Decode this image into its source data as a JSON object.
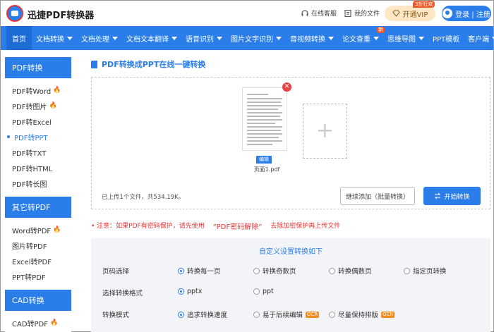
{
  "header": {
    "brand": "迅捷PDF转换器",
    "online_service": "在线客服",
    "my_files": "我的文件",
    "vip_badge": "3折狂欢",
    "vip_label": "开通VIP",
    "login_label": "登录 | 注册"
  },
  "nav": {
    "items": [
      {
        "label": "首页",
        "caret": false
      },
      {
        "label": "文档转换",
        "caret": true
      },
      {
        "label": "文档处理",
        "caret": true
      },
      {
        "label": "文档文本翻译",
        "caret": true
      },
      {
        "label": "语音识别",
        "caret": true
      },
      {
        "label": "图片文字识别",
        "caret": true
      },
      {
        "label": "音视频转换",
        "caret": true
      },
      {
        "label": "论文查重",
        "caret": true,
        "badge": "新"
      },
      {
        "label": "思维导图",
        "caret": true
      },
      {
        "label": "PPT模板",
        "caret": false
      },
      {
        "label": "客户端",
        "caret": true
      }
    ]
  },
  "sidebar": {
    "sections": [
      {
        "title": "PDF转换",
        "items": [
          {
            "label": "PDF转Word",
            "hot": true
          },
          {
            "label": "PDF转图片",
            "hot": true
          },
          {
            "label": "PDF转Excel",
            "hot": false
          },
          {
            "label": "PDF转PPT",
            "hot": false,
            "active": true
          },
          {
            "label": "PDF转TXT",
            "hot": false
          },
          {
            "label": "PDF转HTML",
            "hot": false
          },
          {
            "label": "PDF转长图",
            "hot": false
          }
        ]
      },
      {
        "title": "其它转PDF",
        "items": [
          {
            "label": "Word转PDF",
            "hot": true
          },
          {
            "label": "图片转PDF",
            "hot": false
          },
          {
            "label": "Excel转PDF",
            "hot": false
          },
          {
            "label": "PPT转PDF",
            "hot": false
          }
        ]
      },
      {
        "title": "CAD转换",
        "items": [
          {
            "label": "CAD转PDF",
            "hot": true
          }
        ]
      }
    ]
  },
  "main": {
    "title": "PDF转换成PPT在线一键转换",
    "upload": {
      "edit_label": "编辑",
      "file_name": "页面1.pdf",
      "status": "已上传1个文件，共534.19K。",
      "batch_add_label": "继续添加（批量转换）",
      "start_label": "开始转换"
    },
    "notice": {
      "prefix": "• 注意：如果PDF有密码保护，请先使用",
      "link": "“PDF密码解除”",
      "suffix": "去除加密保护再上传文件"
    },
    "settings": {
      "title": "自定义设置转换如下",
      "rows": [
        {
          "label": "页码选择",
          "options": [
            {
              "label": "转换每一页",
              "selected": true,
              "ocr": false
            },
            {
              "label": "转换奇数页",
              "selected": false,
              "ocr": false
            },
            {
              "label": "转换偶数页",
              "selected": false,
              "ocr": false
            },
            {
              "label": "指定页转换",
              "selected": false,
              "ocr": false
            }
          ]
        },
        {
          "label": "选择转换格式",
          "options": [
            {
              "label": "pptx",
              "selected": true,
              "ocr": false
            },
            {
              "label": "ppt",
              "selected": false,
              "ocr": false
            }
          ]
        },
        {
          "label": "转换模式",
          "options": [
            {
              "label": "追求转换速度",
              "selected": true,
              "ocr": false
            },
            {
              "label": "易于后续编辑",
              "selected": false,
              "ocr": true
            },
            {
              "label": "尽量保持排版",
              "selected": false,
              "ocr": true
            }
          ]
        }
      ],
      "ocr_label": "OCR"
    }
  },
  "colors": {
    "primary": "#2b7de9",
    "danger": "#e33333",
    "hot": "#f05a28",
    "vip_bg": "#fde7c4"
  }
}
